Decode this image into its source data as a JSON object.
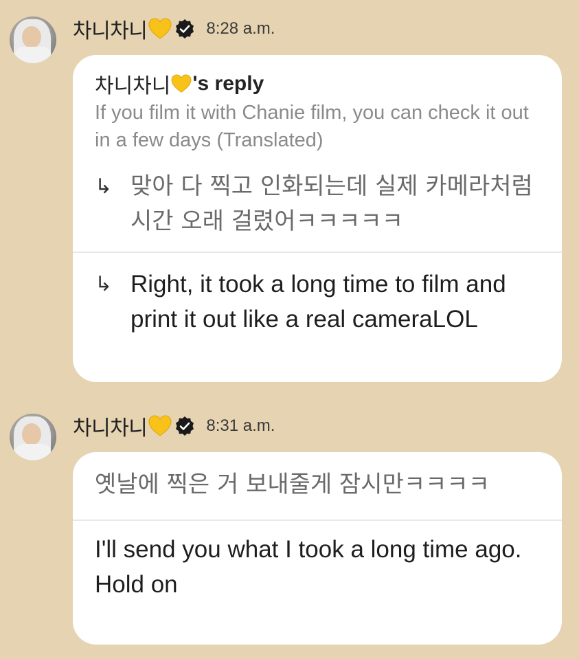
{
  "messages": [
    {
      "sender": "차니차니",
      "time": "8:28 a.m.",
      "reply": {
        "title_name": "차니차니",
        "title_suffix": "'s reply",
        "text": "If you film it with Chanie film, you can check it out in a few days (Translated)"
      },
      "original": "맞아 다 찍고 인화되는데 실제 카메라처럼 시간 오래 걸렸어ㅋㅋㅋㅋㅋ",
      "translation": "Right, it took a long time to film and print it out like a real cameraLOL",
      "arrow": "↳"
    },
    {
      "sender": "차니차니",
      "time": "8:31 a.m.",
      "original": "옛날에 찍은 거 보내줄게 잠시만ㅋㅋㅋㅋ",
      "translation": "I'll send you what I took a long time ago. Hold on"
    }
  ],
  "icons": {
    "heart": "yellow-heart-icon",
    "verified": "verified-badge-icon",
    "heart_color": "#f9c21a",
    "verified_color": "#1a1a1a"
  },
  "colors": {
    "background": "#e5d3b1",
    "bubble": "#ffffff",
    "muted_text": "#8a8a8a"
  }
}
